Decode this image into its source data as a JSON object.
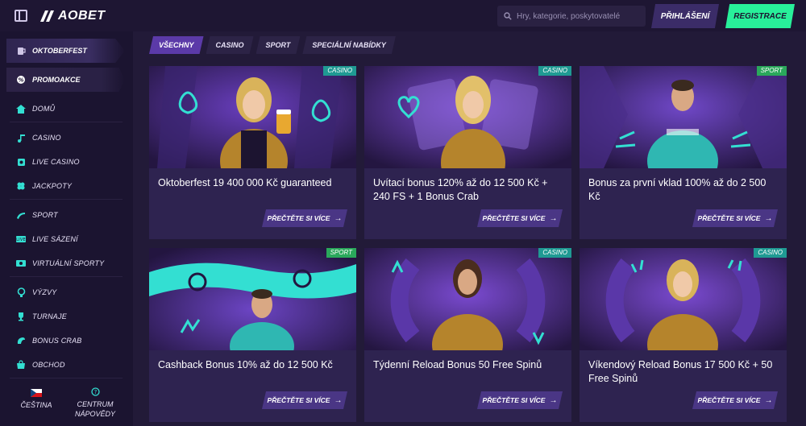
{
  "header": {
    "logo_text": "AOBET",
    "search_placeholder": "Hry, kategorie, poskytovatelé",
    "login_label": "PŘIHLÁŠENÍ",
    "register_label": "REGISTRACE"
  },
  "sidebar": {
    "promo_items": [
      {
        "label": "OKTOBERFEST",
        "icon": "mug-icon"
      },
      {
        "label": "PROMOAKCE",
        "icon": "promo-icon"
      }
    ],
    "items": [
      {
        "label": "DOMŮ",
        "icon": "home-icon"
      },
      {
        "label": "CASINO",
        "icon": "music-note-icon"
      },
      {
        "label": "LIVE CASINO",
        "icon": "live-casino-icon"
      },
      {
        "label": "JACKPOTY",
        "icon": "clover-icon"
      },
      {
        "label": "SPORT",
        "icon": "sport-icon"
      },
      {
        "label": "LIVE SÁZENÍ",
        "icon": "live-bet-icon"
      },
      {
        "label": "VIRTUÁLNÍ SPORTY",
        "icon": "virtual-sport-icon"
      },
      {
        "label": "VÝZVY",
        "icon": "challenge-icon"
      },
      {
        "label": "TURNAJE",
        "icon": "trophy-icon"
      },
      {
        "label": "BONUS CRAB",
        "icon": "crab-icon"
      },
      {
        "label": "OBCHOD",
        "icon": "shop-icon"
      }
    ],
    "language_label": "ČEŠTINA",
    "help_label_line1": "CENTRUM",
    "help_label_line2": "NÁPOVĚDY"
  },
  "tabs": [
    "VŠECHNY",
    "CASINO",
    "SPORT",
    "SPECIÁLNÍ NABÍDKY"
  ],
  "cards": [
    {
      "title": "Oktoberfest 19 400 000 Kč guaranteed",
      "badge": "CASINO",
      "more_label": "PŘEČTĚTE SI VÍCE"
    },
    {
      "title": "Uvítací bonus 120% až do 12 500 Kč + 240 FS + 1 Bonus Crab",
      "badge": "CASINO",
      "more_label": "PŘEČTĚTE SI VÍCE"
    },
    {
      "title": "Bonus za první vklad 100% až do 2 500 Kč",
      "badge": "SPORT",
      "more_label": "PŘEČTĚTE SI VÍCE"
    },
    {
      "title": "Cashback Bonus 10% až do 12 500 Kč",
      "badge": "SPORT",
      "more_label": "PŘEČTĚTE SI VÍCE"
    },
    {
      "title": "Týdenní Reload Bonus 50 Free Spinů",
      "badge": "CASINO",
      "more_label": "PŘEČTĚTE SI VÍCE"
    },
    {
      "title": "Víkendový Reload Bonus 17 500 Kč + 50 Free Spinů",
      "badge": "CASINO",
      "more_label": "PŘEČTĚTE SI VÍCE"
    }
  ],
  "colors": {
    "accent_green": "#28f09a",
    "accent_teal": "#33dfd2",
    "active_tab": "#5b3aa8"
  }
}
